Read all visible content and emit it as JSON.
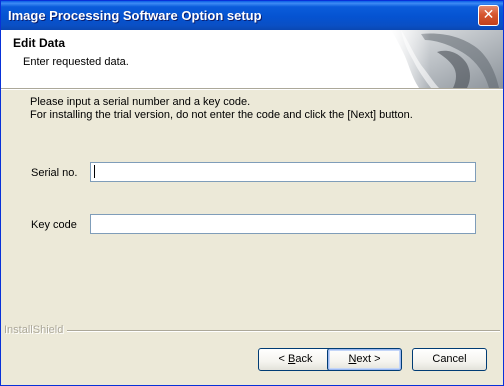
{
  "window": {
    "title": "Image Processing Software Option setup",
    "close_glyph": "✕"
  },
  "header": {
    "title": "Edit Data",
    "subtitle": "Enter requested data."
  },
  "body": {
    "instruction_line1": "Please input a serial number and a key code.",
    "instruction_line2": "For installing the trial version, do not enter the code and click the [Next] button."
  },
  "form": {
    "serial_label": "Serial no.",
    "serial_value": "",
    "key_label": "Key code",
    "key_value": ""
  },
  "footer": {
    "brand": "InstallShield",
    "back_prefix": "< ",
    "back_mnemonic": "B",
    "back_rest": "ack",
    "next_mnemonic": "N",
    "next_rest": "ext >",
    "cancel_label": "Cancel"
  },
  "colors": {
    "titlebar": "#0553D1",
    "dialog_bg": "#ECE9D8",
    "field_border": "#7F9DB9"
  },
  "icons": {
    "close": "close-icon",
    "header_art": "installshield-header-graphic"
  }
}
